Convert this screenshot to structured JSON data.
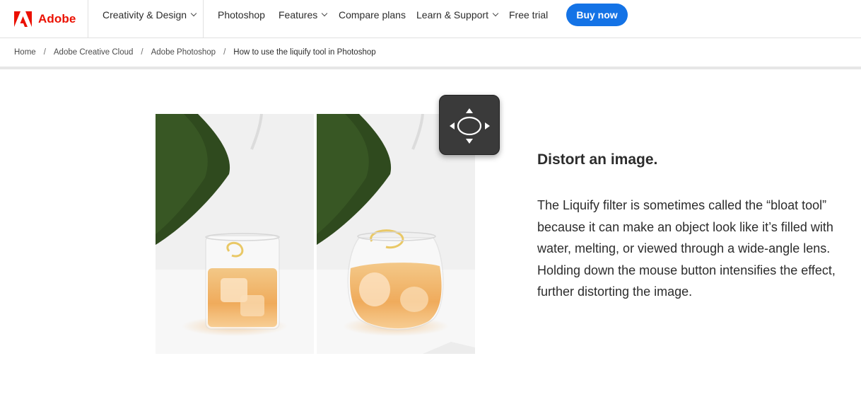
{
  "nav": {
    "brand": "Adobe",
    "items": [
      {
        "label": "Creativity & Design",
        "dropdown": true
      },
      {
        "label": "Photoshop",
        "dropdown": false
      },
      {
        "label": "Features",
        "dropdown": true
      },
      {
        "label": "Compare plans",
        "dropdown": false
      },
      {
        "label": "Learn & Support",
        "dropdown": true
      },
      {
        "label": "Free trial",
        "dropdown": false
      }
    ],
    "buy_button": "Buy now",
    "brand_color": "#eb1000",
    "accent_color": "#1473e6"
  },
  "breadcrumb": {
    "items": [
      "Home",
      "Adobe Creative Cloud",
      "Adobe Photoshop"
    ],
    "current": "How to use the liquify tool in Photoshop",
    "separator": "/"
  },
  "content": {
    "heading": "Distort an image.",
    "paragraph": "The Liquify filter is sometimes called the “bloat tool” because it can make an object look like it’s filled with water, melting, or viewed through a wide-angle lens. Holding down the mouse button intensifies the effect, further distorting the image.",
    "tool_icon": "liquify-bloat-tool-icon"
  }
}
